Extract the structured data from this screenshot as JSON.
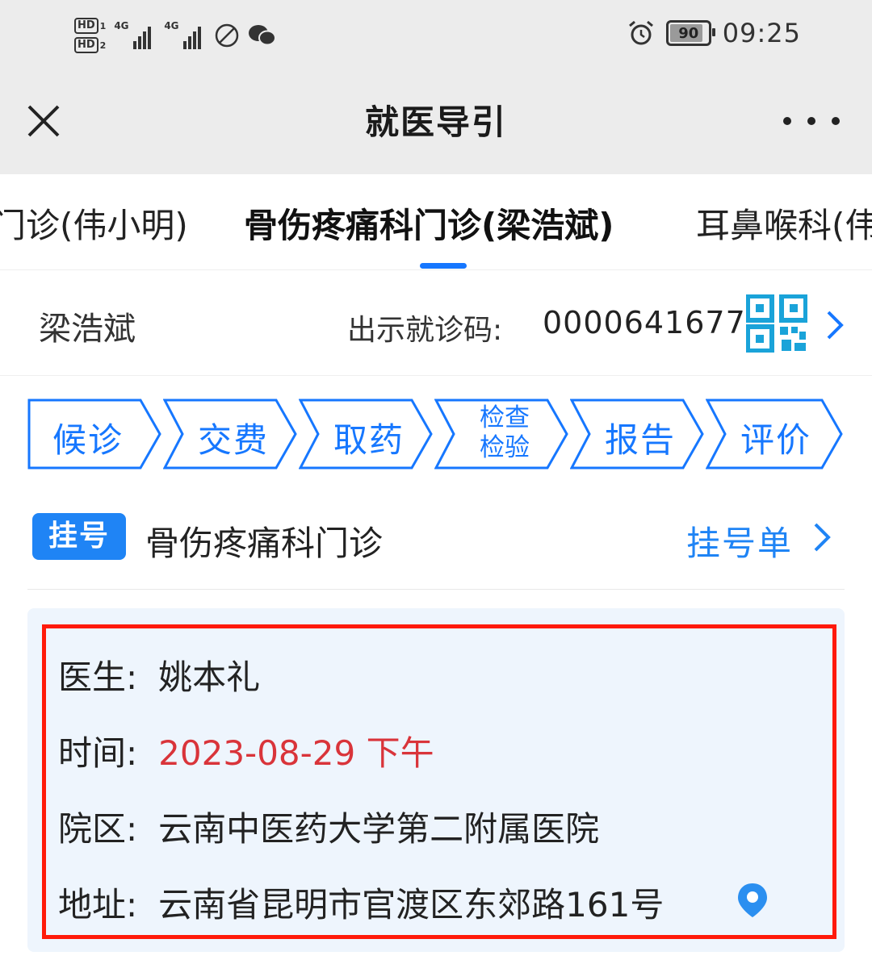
{
  "status_bar": {
    "sim1": "HD",
    "sim1_slot": "1",
    "sim2": "HD",
    "sim2_slot": "2",
    "net1": "4G",
    "net2": "4G",
    "battery": "90",
    "time": "09:25",
    "icons": [
      "signal-icon",
      "signal-icon",
      "nfc-icon",
      "wechat-icon",
      "alarm-icon",
      "battery-icon"
    ]
  },
  "header": {
    "title": "就医导引"
  },
  "tabs": [
    {
      "label": "门诊(伟小明)",
      "active": false
    },
    {
      "label": "骨伤疼痛科门诊(梁浩斌)",
      "active": true
    },
    {
      "label": "耳鼻喉科(伟"
    }
  ],
  "patient": {
    "name": "梁浩斌",
    "code_label": "出示就诊码:",
    "code_value": "0000641677"
  },
  "steps": [
    {
      "label": "候诊"
    },
    {
      "label": "交费"
    },
    {
      "label": "取药"
    },
    {
      "label_line1": "检查",
      "label_line2": "检验"
    },
    {
      "label": "报告"
    },
    {
      "label": "评价"
    }
  ],
  "registration": {
    "badge": "挂号",
    "department": "骨伤疼痛科门诊",
    "link": "挂号单"
  },
  "details": {
    "doctor_label": "医生:",
    "doctor": "姚本礼",
    "time_label": "时间:",
    "time": "2023-08-29 下午",
    "campus_label": "院区:",
    "campus": "云南中医药大学第二附属医院",
    "address_label": "地址:",
    "address": "云南省昆明市官渡区东郊路161号"
  },
  "colors": {
    "accent": "#1677ff",
    "badge": "#1f84f5",
    "highlight_frame": "#ff1a0a",
    "time_text": "#d9343a",
    "card_bg": "#eef5fd"
  }
}
